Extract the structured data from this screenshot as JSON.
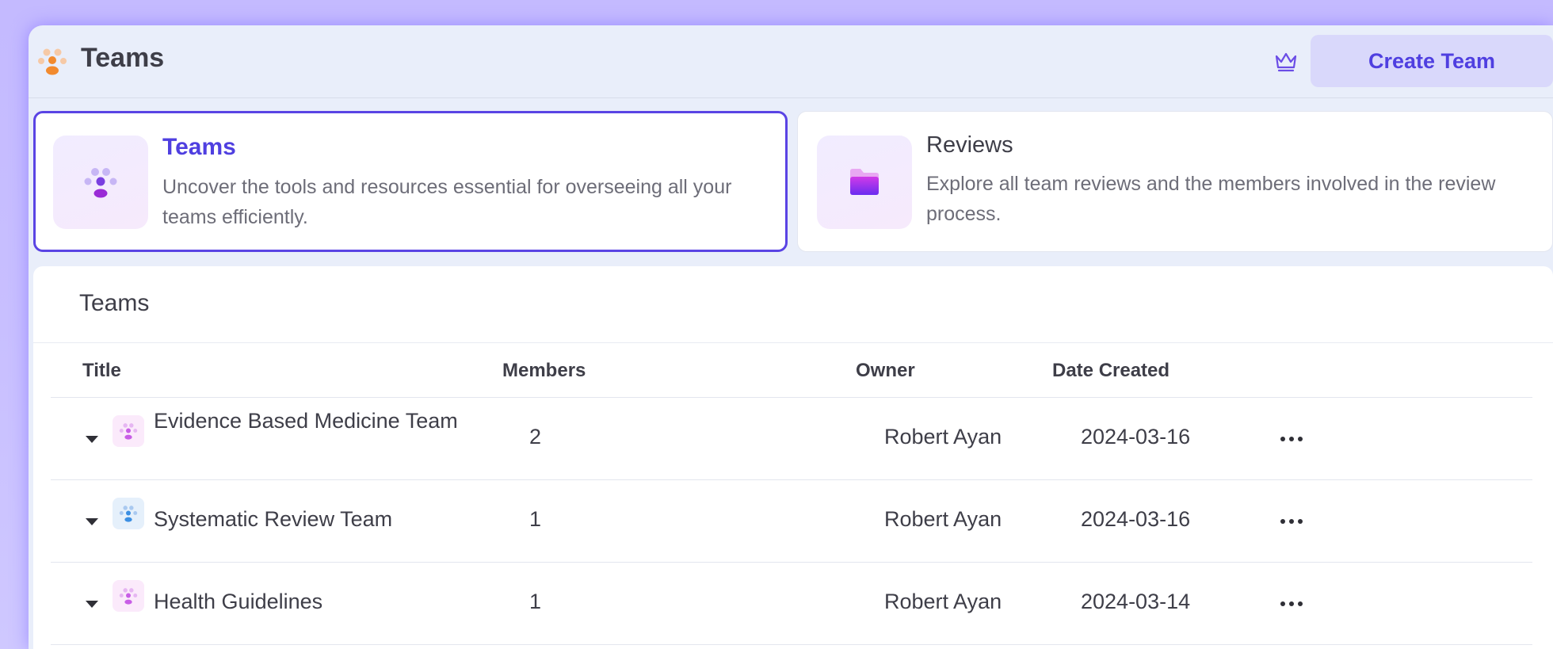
{
  "header": {
    "title": "Teams",
    "logo_icon": "team-logo-icon",
    "crown_icon": "crown-icon",
    "create_button_label": "Create Team"
  },
  "cards": [
    {
      "title": "Teams",
      "description": "Uncover the tools and resources essential for overseeing all your teams efficiently.",
      "icon": "team-icon",
      "selected": true
    },
    {
      "title": "Reviews",
      "description": "Explore all team reviews and the members involved in the review process.",
      "icon": "folder-icon",
      "selected": false
    }
  ],
  "panel": {
    "title": "Teams",
    "columns": [
      "Title",
      "Members",
      "Owner",
      "Date Created"
    ],
    "rows": [
      {
        "title": "Evidence Based Medicine Team",
        "members": "2",
        "owner": "Robert Ayan",
        "date_created": "2024-03-16",
        "icon_color": "pink"
      },
      {
        "title": "Systematic Review Team",
        "members": "1",
        "owner": "Robert Ayan",
        "date_created": "2024-03-16",
        "icon_color": "blue"
      },
      {
        "title": "Health Guidelines",
        "members": "1",
        "owner": "Robert Ayan",
        "date_created": "2024-03-14",
        "icon_color": "pink"
      }
    ]
  },
  "colors": {
    "accent": "#4f3fe0",
    "background": "#e9eefa",
    "glow": "#c4baff"
  }
}
